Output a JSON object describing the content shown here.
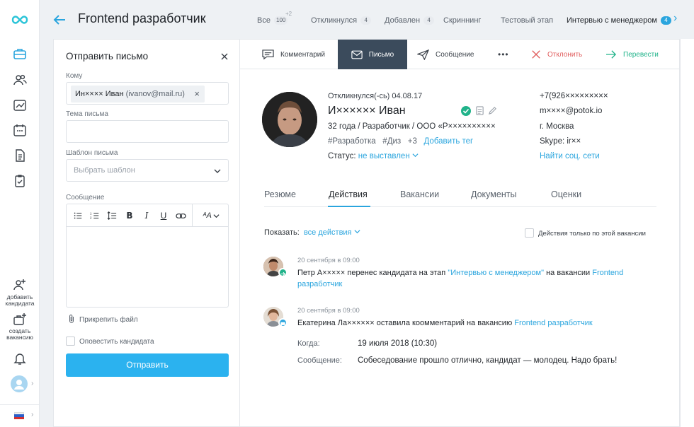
{
  "nav": {
    "add_candidate": "добавить кандидата",
    "create_vacancy": "создать вакансию"
  },
  "header": {
    "title": "Frontend разработчик",
    "extra_badge": "+2",
    "stages": [
      {
        "label": "Все",
        "count": "100"
      },
      {
        "label": "Откликнулся",
        "count": "4"
      },
      {
        "label": "Добавлен",
        "count": "4"
      },
      {
        "label": "Скриннинг",
        "count": ""
      },
      {
        "label": "Тестовый этап",
        "count": ""
      },
      {
        "label": "Интервью с менеджером",
        "count": "4"
      }
    ]
  },
  "email": {
    "title": "Отправить письмо",
    "to_label": "Кому",
    "to_name": "Ин×××× Иван",
    "to_email": "(ivanov@mail.ru)",
    "subject_label": "Тема письма",
    "template_label": "Шаблон письма",
    "template_placeholder": "Выбрать шаблон",
    "message_label": "Сообщение",
    "attach": "Прикрепить файл",
    "notify": "Оповестить кандидата",
    "send": "Отправить"
  },
  "actions": {
    "comment": "Комментарий",
    "letter": "Письмо",
    "message": "Сообщение",
    "more": "•••",
    "reject": "Отклонить",
    "transfer": "Перевести"
  },
  "profile": {
    "responded": "Откликнулся(-сь) 04.08.17",
    "name": "И×××××× Иван",
    "details": "32 года / Разработчик / ООО «Р××××××××××",
    "tag1": "#Разработка",
    "tag2": "#Диз",
    "tag_more": "+3",
    "add_tag": "Добавить тег",
    "status_label": "Статус:",
    "status_value": "не выставлен",
    "phone": "+7(926×××××××××",
    "email": "m××××@potok.io",
    "city": "г. Москва",
    "skype": "Skype: ir××",
    "social": "Найти соц. сети"
  },
  "tabs": [
    "Резюме",
    "Действия",
    "Вакансии",
    "Документы",
    "Оценки"
  ],
  "filter": {
    "label": "Показать:",
    "value": "все действия",
    "only_this": "Действия только по этой вакансии"
  },
  "events": [
    {
      "date": "20 сентября в 09:00",
      "actor": "Петр А×××××",
      "text1": " перенес кандидата на этап ",
      "stage": "\"Интервью с менеджером\"",
      "text2": " на вакансии ",
      "vacancy_part1": "Frontend",
      "vacancy_part2": "разработчик"
    },
    {
      "date": "20 сентября в 09:00",
      "actor": "Екатерина Ла××××××",
      "text1": " оставила коомментарий на вакансию ",
      "vacancy": "Frontend разработчик",
      "when_label": "Когда:",
      "when_value": "19 июля 2018 (10:30)",
      "msg_label": "Сообщение:",
      "msg_value": "Собеседование прошло отлично, кандидат — молодец. Надо брать!"
    }
  ],
  "colors": {
    "accent": "#2aa5de",
    "button": "#2bb2ef",
    "active_action": "#3b4b5c",
    "reject": "#e05c5c",
    "transfer": "#21b38a"
  }
}
